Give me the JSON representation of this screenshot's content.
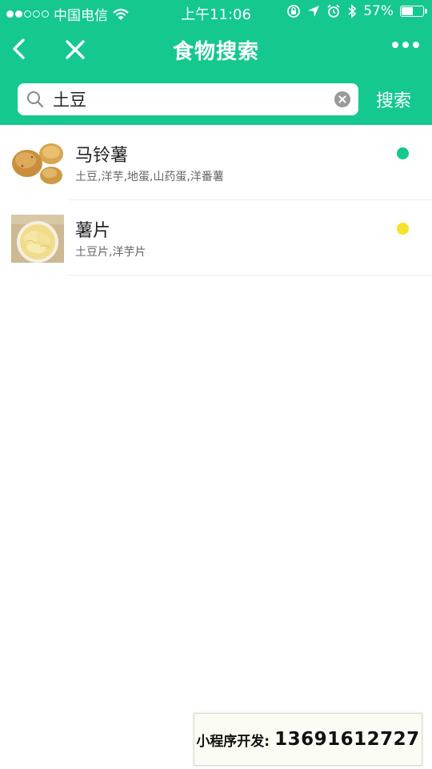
{
  "status_bar": {
    "carrier": "中国电信",
    "time": "上午11:06",
    "battery_percent": "57%",
    "battery_level": 0.57,
    "signal_dots": [
      true,
      true,
      false,
      false,
      false
    ]
  },
  "nav": {
    "title": "食物搜索",
    "back_icon": "chevron-left-icon",
    "close_icon": "close-icon",
    "more_icon": "more-dots-icon"
  },
  "search": {
    "query": "土豆",
    "button_label": "搜索"
  },
  "results": [
    {
      "name": "马铃薯",
      "aliases": "土豆,洋芋,地蛋,山药蛋,洋番薯",
      "status_color": "#14c88f",
      "image": "potato"
    },
    {
      "name": "薯片",
      "aliases": "土豆片,洋芋片",
      "status_color": "#f7e22b",
      "image": "potato-chips"
    }
  ],
  "contact": {
    "label": "小程序开发:",
    "phone": "13691612727"
  },
  "colors": {
    "brand": "#14c88f"
  }
}
